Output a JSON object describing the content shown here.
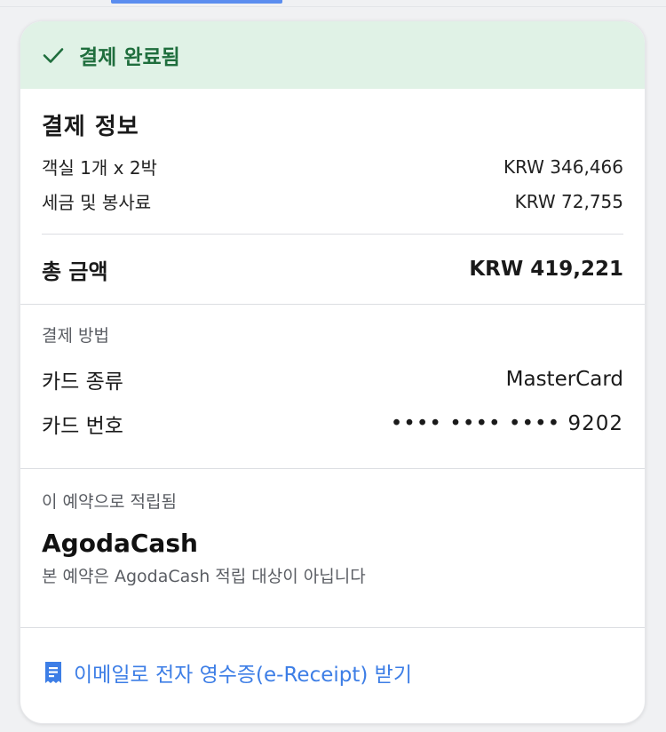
{
  "banner": {
    "status_text": "결제 완료됨",
    "icon": "check-icon",
    "color": "#1f6e3d",
    "background": "#e0f2e6"
  },
  "payment_info": {
    "title": "결제 정보",
    "lines": [
      {
        "label": "객실 1개 x 2박",
        "value": "KRW 346,466"
      },
      {
        "label": "세금 및 봉사료",
        "value": "KRW 72,755"
      }
    ],
    "total": {
      "label": "총 금액",
      "value": "KRW 419,221"
    }
  },
  "payment_method": {
    "section_label": "결제 방법",
    "card_type": {
      "label": "카드 종류",
      "value": "MasterCard"
    },
    "card_number": {
      "label": "카드 번호",
      "value": "•••• •••• •••• 9202"
    }
  },
  "earnings": {
    "section_label": "이 예약으로 적립됨",
    "title": "AgodaCash",
    "note": "본 예약은 AgodaCash 적립 대상이 아닙니다"
  },
  "receipt": {
    "link_text": "이메일로 전자 영수증(e-Receipt) 받기",
    "icon": "receipt-icon",
    "color": "#3d7ee6"
  }
}
